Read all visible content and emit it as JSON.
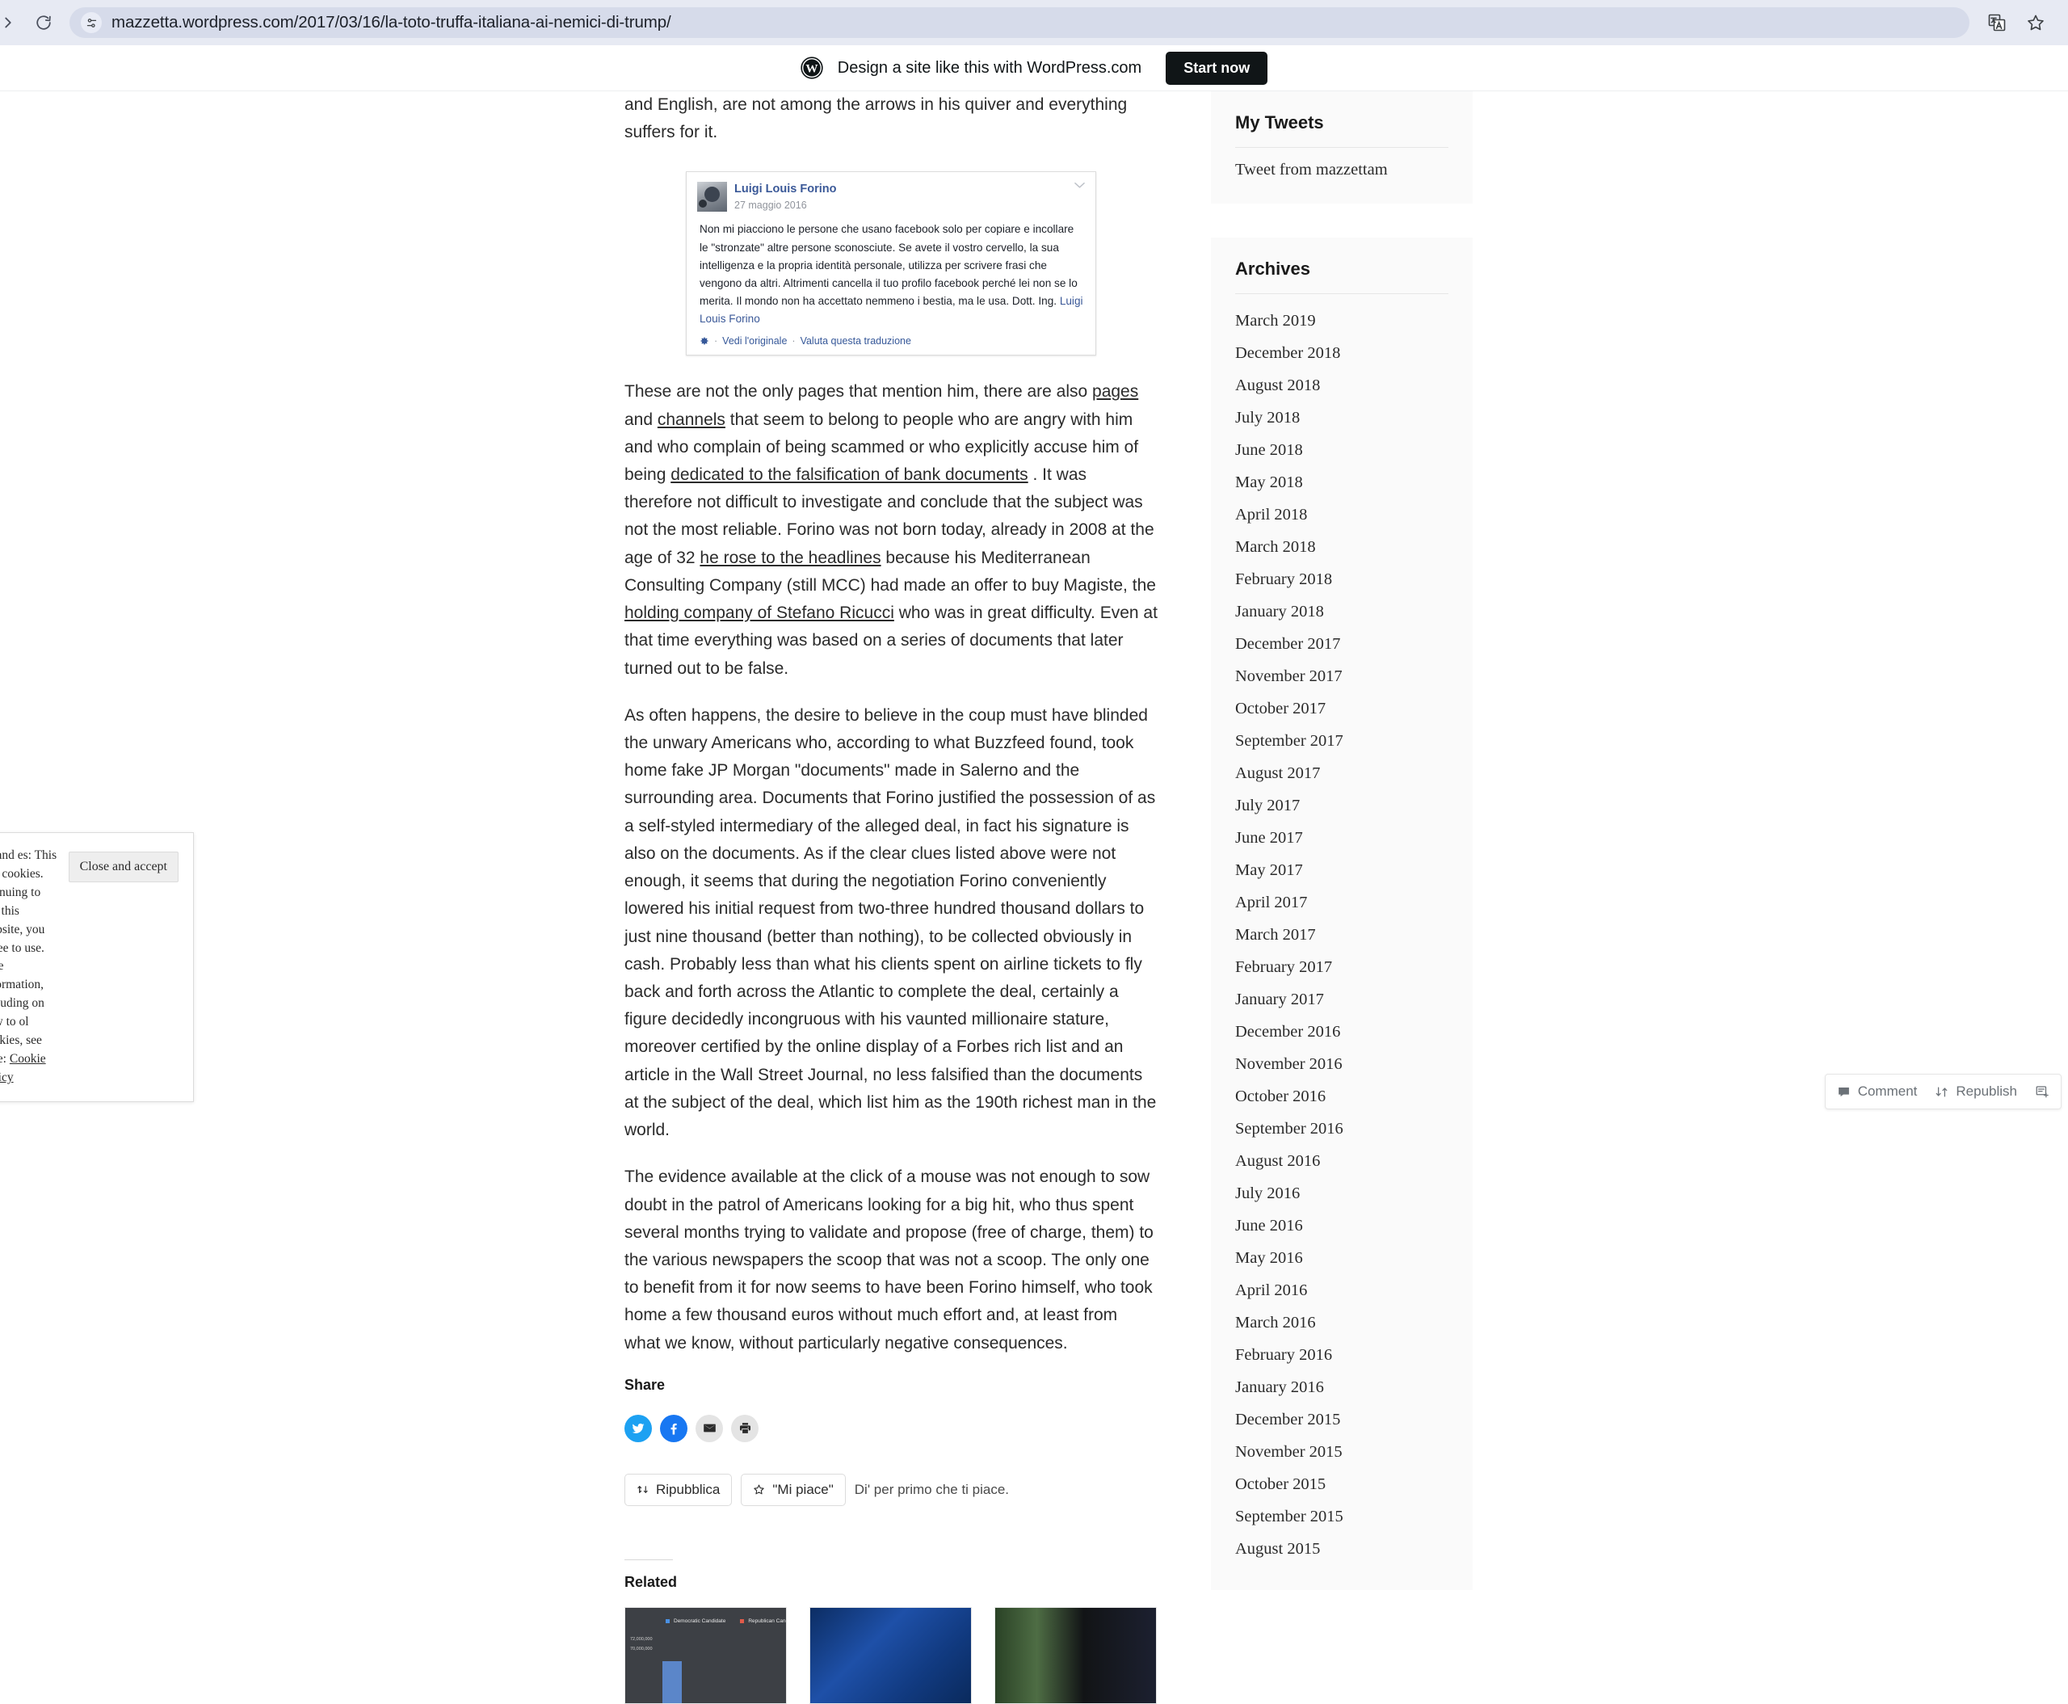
{
  "browser": {
    "url": "mazzetta.wordpress.com/2017/03/16/la-toto-truffa-italiana-ai-nemici-di-trump/",
    "forward_icon": "arrow-forward-icon",
    "reload_icon": "reload-icon",
    "site_info_icon": "site-settings-icon",
    "translate_icon": "translate-icon",
    "bookmark_icon": "bookmark-star-icon"
  },
  "promo": {
    "logo": "wordpress-logo-icon",
    "text": "Design a site like this with WordPress.com",
    "cta": "Start now"
  },
  "article": {
    "lead_fragment": "and English, are not among the arrows in his quiver and everything suffers for it.",
    "quote_card": {
      "author": "Luigi Louis Forino",
      "date": "27 maggio 2016",
      "caret_icon": "chevron-down-icon",
      "body_main": "Non mi piacciono le persone che usano facebook solo per copiare e incollare le \"stronzate\" altre persone sconosciute. Se avete il vostro cervello, la sua intelligenza e la propria identità personale, utilizza per scrivere frasi che vengono da altri. Altrimenti cancella il tuo profilo facebook perché lei non se lo merita. Il mondo non ha accettato nemmeno i bestia, ma le usa. Dott. Ing. ",
      "body_mention": "Luigi Louis Forino",
      "gear_icon": "gear-icon",
      "link_original": "Vedi l'originale",
      "link_rate": "Valuta questa traduzione",
      "separator": "·",
      "avatar": "author-avatar"
    },
    "paragraphs": [
      {
        "segments": [
          {
            "t": "These are not the only pages that mention him, there are also ",
            "link": false
          },
          {
            "t": "pages",
            "link": true
          },
          {
            "t": " and ",
            "link": false
          },
          {
            "t": "channels",
            "link": true
          },
          {
            "t": " that seem to belong to people who are angry with him and who complain of being scammed or who explicitly accuse him of being ",
            "link": false
          },
          {
            "t": "dedicated to the falsification of bank documents",
            "link": true
          },
          {
            "t": " . It was therefore not difficult to investigate and conclude that the subject was not the most reliable. Forino was not born today, already in 2008 at the age of 32 ",
            "link": false
          },
          {
            "t": "he rose to the headlines",
            "link": true
          },
          {
            "t": " because his Mediterranean Consulting Company (still MCC) had made an offer to buy Magiste, the ",
            "link": false
          },
          {
            "t": "holding company of Stefano Ricucci",
            "link": true
          },
          {
            "t": " who was in great difficulty. Even at that time everything was based on a series of documents that later turned out to be false.",
            "link": false
          }
        ]
      },
      {
        "segments": [
          {
            "t": "As often happens, the desire to believe in the coup must have blinded the unwary Americans who, according to what Buzzfeed found, took home fake JP Morgan \"documents\" made in Salerno and the surrounding area. Documents that Forino justified the possession of as a self-styled intermediary of the alleged deal, in fact his signature is also on the documents. As if the clear clues listed above were not enough, it seems that during the negotiation Forino conveniently lowered his initial request from two-three hundred thousand dollars to just nine thousand (better than nothing), to be collected obviously in cash. Probably less than what his clients spent on airline tickets to fly back and forth across the Atlantic to complete the deal, certainly a figure decidedly incongruous with his vaunted millionaire stature, moreover certified by the online display of a Forbes rich list and an article in the Wall Street Journal, no less falsified than the documents at the subject of the deal, which list him as the 190th richest man in the world.",
            "link": false
          }
        ]
      },
      {
        "segments": [
          {
            "t": "The evidence available at the click of a mouse was not enough to sow doubt in the patrol of Americans looking for a big hit, who thus spent several months trying to validate and propose (free of charge, them) to the various newspapers the scoop that was not a scoop. The only one to benefit from it for now seems to have been Forino himself, who took home a few thousand euros without much effort and, at least from what we know, without particularly negative consequences.",
            "link": false
          }
        ]
      }
    ]
  },
  "share": {
    "heading": "Share",
    "icons": [
      {
        "name": "twitter-share-icon",
        "label": "Twitter",
        "color": "#1da1f2"
      },
      {
        "name": "facebook-share-icon",
        "label": "Facebook",
        "color": "#1877f2"
      },
      {
        "name": "email-share-icon",
        "label": "Email",
        "color": "#e4e4e4"
      },
      {
        "name": "print-share-icon",
        "label": "Print",
        "color": "#e4e4e4"
      }
    ],
    "reblog_label": "Ripubblica",
    "like_label": "\"Mi piace\"",
    "like_hint": "Di' per primo che ti piace."
  },
  "related": {
    "heading": "Related",
    "thumbnails": [
      {
        "name": "related-thumb-election-chart",
        "legend": [
          "Democratic Candidate",
          "Republican Candidate"
        ],
        "axis_labels": [
          "72,000,000",
          "70,000,000"
        ]
      },
      {
        "name": "related-thumb-crowd-photo",
        "legend": [],
        "axis_labels": []
      },
      {
        "name": "related-thumb-news-interview",
        "legend": [],
        "axis_labels": []
      }
    ]
  },
  "sidebar": {
    "tweets_widget": {
      "title": "My Tweets",
      "item": "Tweet from mazzettam"
    },
    "archives_widget": {
      "title": "Archives",
      "items": [
        "March 2019",
        "December 2018",
        "August 2018",
        "July 2018",
        "June 2018",
        "May 2018",
        "April 2018",
        "March 2018",
        "February 2018",
        "January 2018",
        "December 2017",
        "November 2017",
        "October 2017",
        "September 2017",
        "August 2017",
        "July 2017",
        "June 2017",
        "May 2017",
        "April 2017",
        "March 2017",
        "February 2017",
        "January 2017",
        "December 2016",
        "November 2016",
        "October 2016",
        "September 2016",
        "August 2016",
        "July 2016",
        "June 2016",
        "May 2016",
        "April 2016",
        "March 2016",
        "February 2016",
        "January 2016",
        "December 2015",
        "November 2015",
        "October 2015",
        "September 2015",
        "August 2015"
      ]
    }
  },
  "cookie_banner": {
    "text": "cy and es: This site cookies. By nuing to use this website, you agree to use. nore information, including on how to ol cookies, see here: ",
    "policy_link": "Cookie Policy",
    "accept_label": "Close and accept"
  },
  "action_bar": {
    "comment_label": "Comment",
    "comment_icon": "comment-bubble-icon",
    "republish_label": "Republish",
    "republish_icon": "republish-arrows-icon",
    "new_post_icon": "new-post-icon"
  }
}
